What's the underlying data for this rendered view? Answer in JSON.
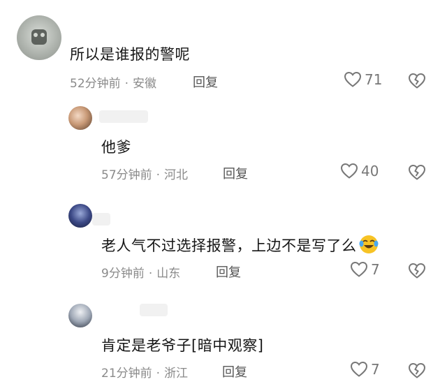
{
  "comments": [
    {
      "text": "所以是谁报的警呢",
      "time": "52分钟前",
      "location": "安徽",
      "reply_label": "回复",
      "likes": "71"
    },
    {
      "text": "他爹",
      "time": "57分钟前",
      "location": "河北",
      "reply_label": "回复",
      "likes": "40"
    },
    {
      "text": "老人气不过选择报警，上边不是写了么",
      "time": "9分钟前",
      "location": "山东",
      "reply_label": "回复",
      "likes": "7"
    },
    {
      "text": "肯定是老爷子[暗中观察]",
      "time": "21分钟前",
      "location": "浙江",
      "reply_label": "回复",
      "likes": "7"
    }
  ],
  "meta_separator": "·",
  "icons": {
    "like": "heart-outline-icon",
    "dislike": "broken-heart-icon",
    "emoji": "laughing-crying-emoji-icon"
  },
  "colors": {
    "text": "#161616",
    "meta": "#8a8a8a",
    "icon": "#777777",
    "emoji_face": "#f7c325"
  }
}
